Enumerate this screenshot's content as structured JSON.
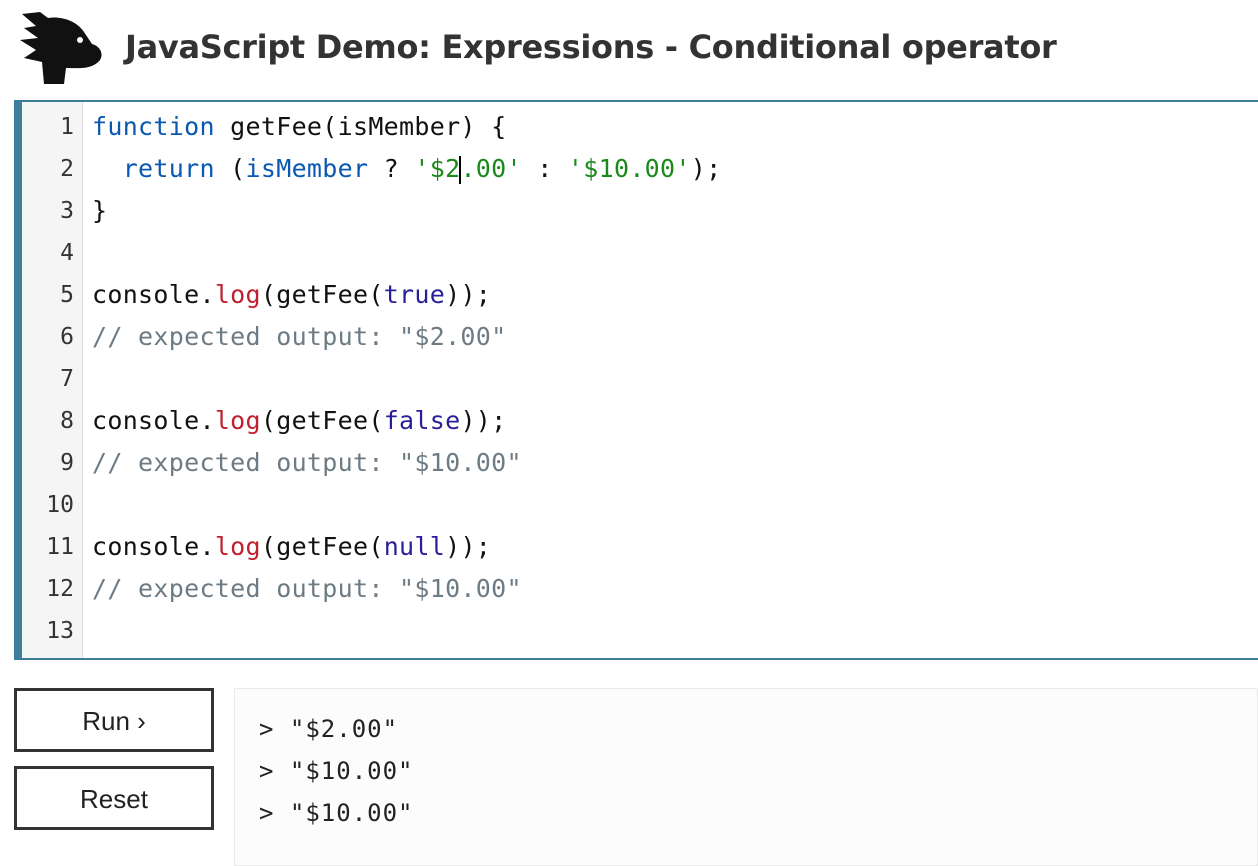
{
  "header": {
    "title": "JavaScript Demo: Expressions - Conditional operator",
    "logo_icon": "dinosaur-head-icon"
  },
  "editor": {
    "lines": [
      {
        "number": "1",
        "tokens": [
          [
            "kw",
            "function"
          ],
          [
            "fn",
            " getFee(isMember) {"
          ]
        ]
      },
      {
        "number": "2",
        "tokens": [
          [
            "fn",
            "  "
          ],
          [
            "kw",
            "return"
          ],
          [
            "fn",
            " ("
          ],
          [
            "kw",
            "isMember"
          ],
          [
            "fn",
            " ? "
          ],
          [
            "str",
            "'$2"
          ],
          [
            "cursor",
            ""
          ],
          [
            "str",
            ".00'"
          ],
          [
            "fn",
            " : "
          ],
          [
            "str",
            "'$10.00'"
          ],
          [
            "fn",
            ");"
          ]
        ]
      },
      {
        "number": "3",
        "tokens": [
          [
            "fn",
            "}"
          ]
        ]
      },
      {
        "number": "4",
        "tokens": []
      },
      {
        "number": "5",
        "tokens": [
          [
            "fn",
            "console."
          ],
          [
            "method",
            "log"
          ],
          [
            "fn",
            "(getFee("
          ],
          [
            "lit",
            "true"
          ],
          [
            "fn",
            "));"
          ]
        ]
      },
      {
        "number": "6",
        "tokens": [
          [
            "cmt",
            "// expected output: \"$2.00\""
          ]
        ]
      },
      {
        "number": "7",
        "tokens": []
      },
      {
        "number": "8",
        "tokens": [
          [
            "fn",
            "console."
          ],
          [
            "method",
            "log"
          ],
          [
            "fn",
            "(getFee("
          ],
          [
            "lit",
            "false"
          ],
          [
            "fn",
            "));"
          ]
        ]
      },
      {
        "number": "9",
        "tokens": [
          [
            "cmt",
            "// expected output: \"$10.00\""
          ]
        ]
      },
      {
        "number": "10",
        "tokens": []
      },
      {
        "number": "11",
        "tokens": [
          [
            "fn",
            "console."
          ],
          [
            "method",
            "log"
          ],
          [
            "fn",
            "(getFee("
          ],
          [
            "lit",
            "null"
          ],
          [
            "fn",
            "));"
          ]
        ]
      },
      {
        "number": "12",
        "tokens": [
          [
            "cmt",
            "// expected output: \"$10.00\""
          ]
        ]
      },
      {
        "number": "13",
        "tokens": []
      }
    ]
  },
  "controls": {
    "run_label": "Run ›",
    "reset_label": "Reset"
  },
  "console": {
    "output": [
      "> \"$2.00\"",
      "> \"$10.00\"",
      "> \"$10.00\""
    ]
  },
  "colors": {
    "accent": "#3d7e9a",
    "keyword": "#0b58b3",
    "string": "#1a8a1a",
    "method": "#c02030",
    "literal": "#2a1e9a",
    "comment": "#6d7b84"
  }
}
